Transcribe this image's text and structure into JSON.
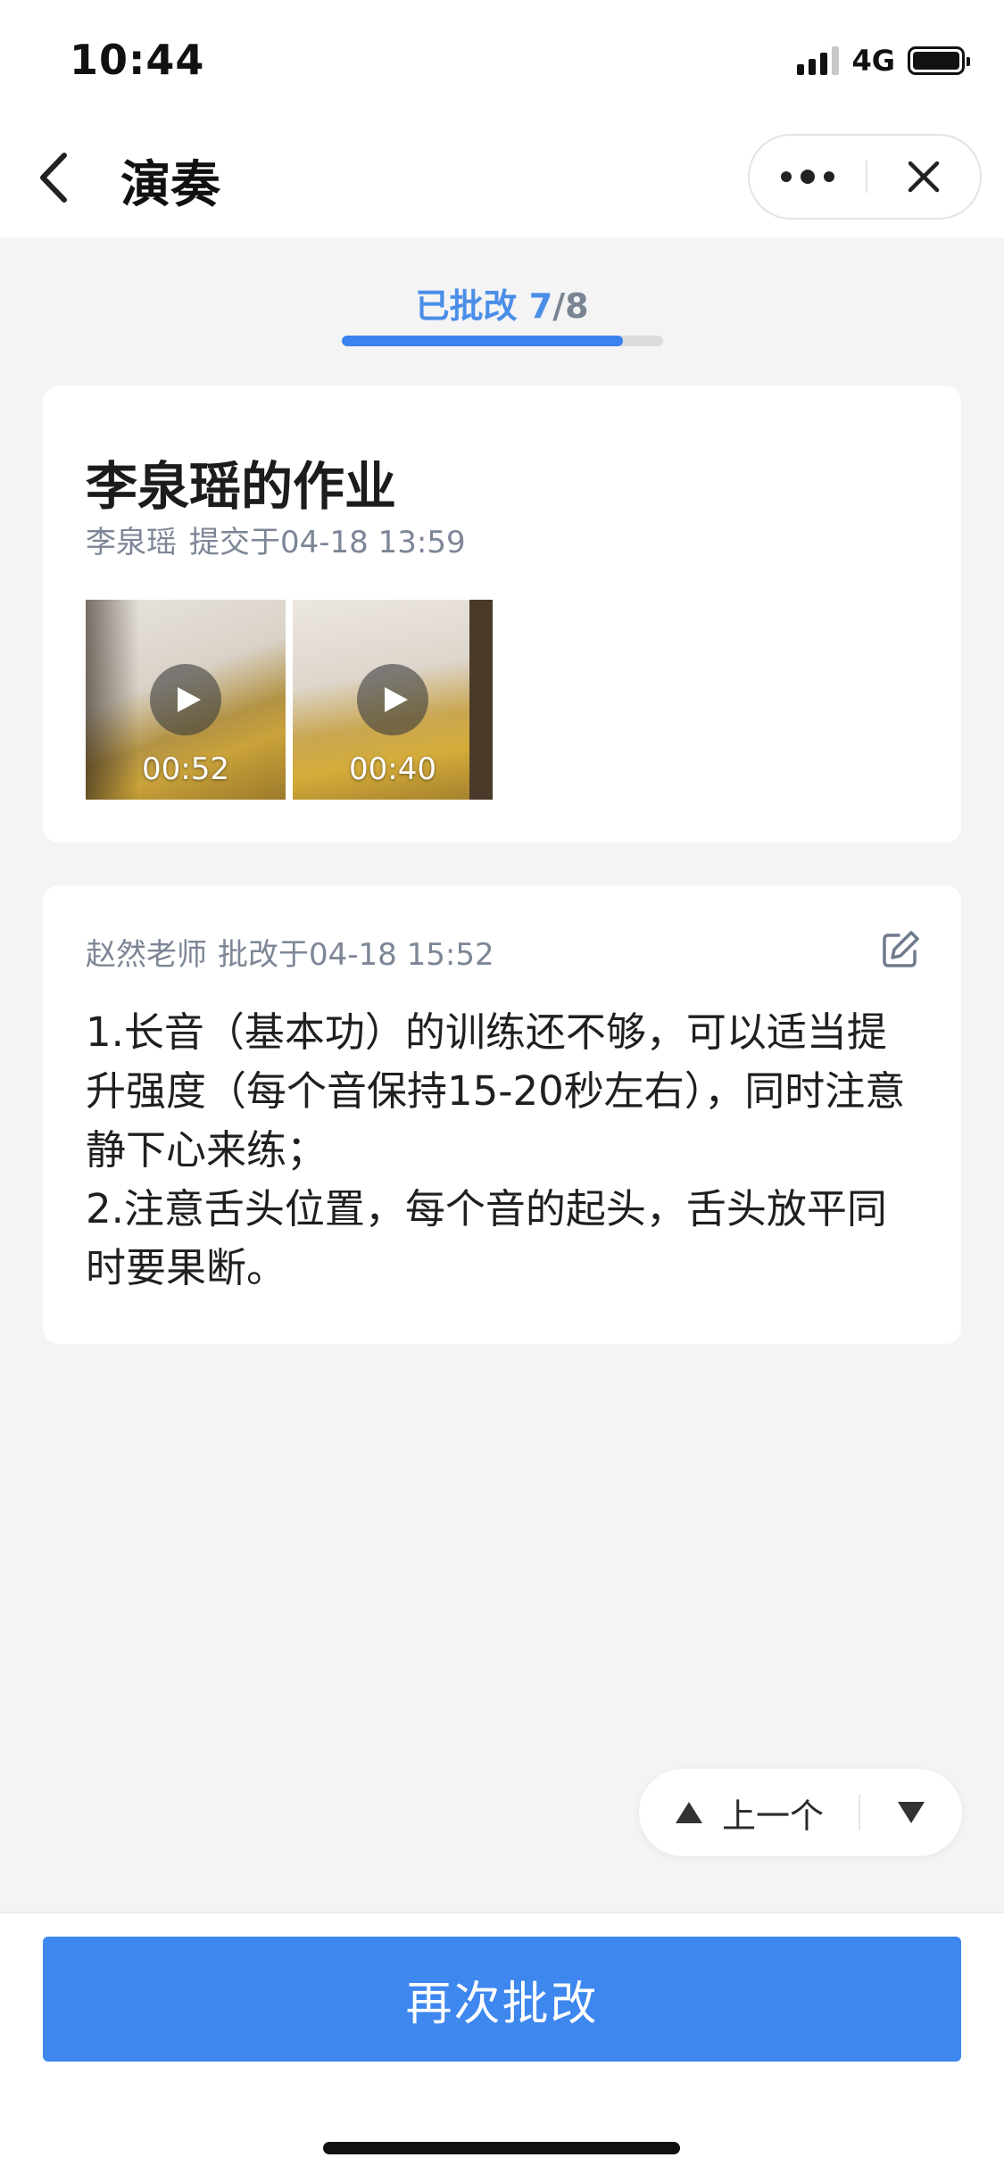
{
  "status_bar": {
    "time": "10:44",
    "network": "4G"
  },
  "nav": {
    "title": "演奏"
  },
  "progress": {
    "label": "已批改",
    "current": "7",
    "total": "/8",
    "fraction": 0.875
  },
  "homework": {
    "title": "李泉瑶的作业",
    "student": "李泉瑶",
    "submitted": "提交于04-18 13:59",
    "videos": [
      {
        "duration": "00:52"
      },
      {
        "duration": "00:40"
      }
    ]
  },
  "feedback": {
    "teacher": "赵然老师",
    "corrected": "批改于04-18 15:52",
    "lines": [
      "1.长音（基本功）的训练还不够，可以适当提升强度（每个音保持15-20秒左右），同时注意静下心来练；",
      "2.注意舌头位置，每个音的起头，舌头放平同时要果断。"
    ]
  },
  "pager": {
    "prev_label": "上一个"
  },
  "actions": {
    "regrade_label": "再次批改"
  },
  "colors": {
    "accent": "#3d87ee",
    "progress": "#3a82f0",
    "meta": "#7c8696"
  }
}
